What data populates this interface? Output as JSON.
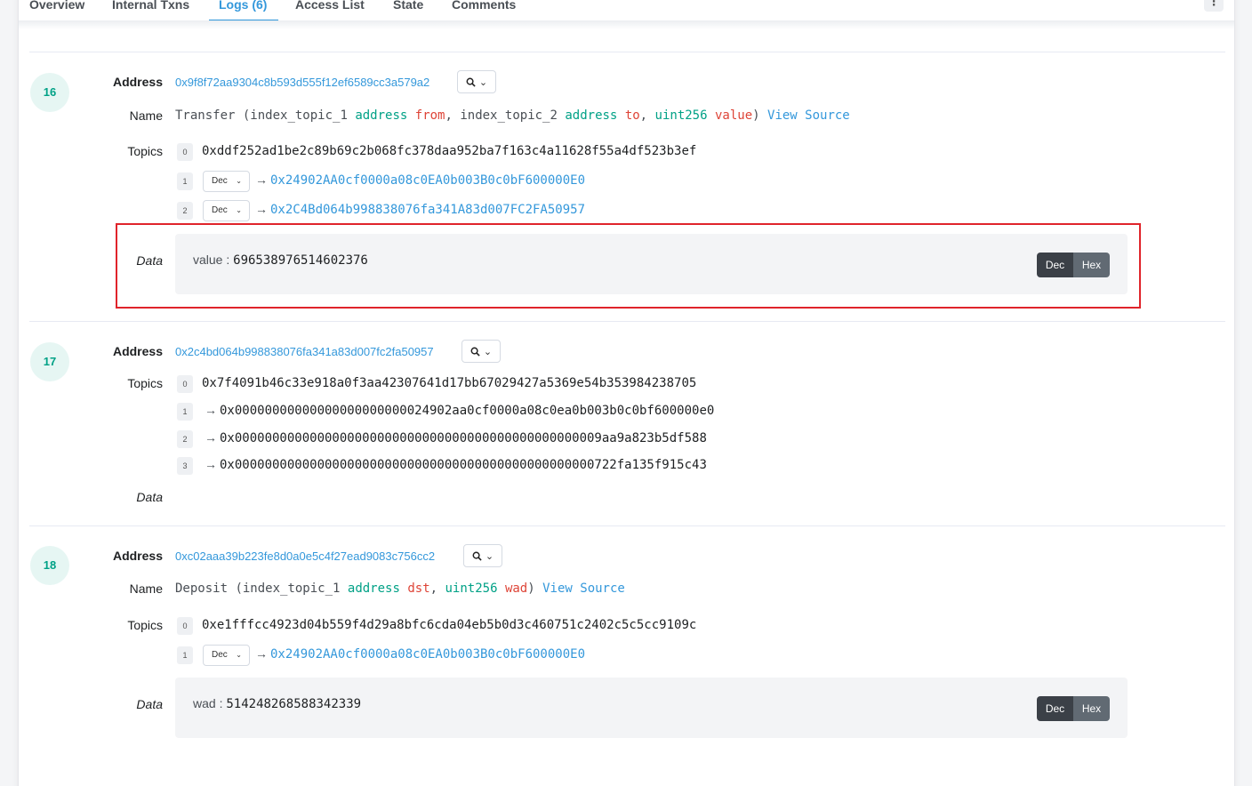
{
  "tabs": [
    "Overview",
    "Internal Txns",
    "Logs (6)",
    "Access List",
    "State",
    "Comments"
  ],
  "active_tab": "Logs (6)",
  "more_icon": "⋮",
  "labels": {
    "address": "Address",
    "name": "Name",
    "topics": "Topics",
    "data": "Data",
    "dec": "Dec",
    "hex": "Hex",
    "view_source": "View Source"
  },
  "logs": [
    {
      "index": "16",
      "address": "0x9f8f72aa9304c8b593d555f12ef6589cc3a579a2",
      "name": {
        "fn": "Transfer",
        "p1": "index_topic_1",
        "t1": "address",
        "n1": "from",
        "p2": "index_topic_2",
        "t2": "address",
        "n2": "to",
        "t3": "uint256",
        "n3": "value"
      },
      "topics": [
        "0xddf252ad1be2c89b69c2b068fc378daa952ba7f163c4a11628f55a4df523b3ef",
        "0x24902AA0cf0000a08c0EA0b003B0c0bF600000E0",
        "0x2C4Bd064b998838076fa341A83d007FC2FA50957"
      ],
      "data": {
        "key": "value",
        "val": "696538976514602376"
      }
    },
    {
      "index": "17",
      "address": "0x2c4bd064b998838076fa341a83d007fc2fa50957",
      "topics": [
        "0x7f4091b46c33e918a0f3aa42307641d17bb67029427a5369e54b353984238705",
        "0x00000000000000000000000024902aa0cf0000a08c0ea0b003b0c0bf600000e0",
        "0x0000000000000000000000000000000000000000000000009aa9a823b5df588",
        "0x000000000000000000000000000000000000000000000000722fa135f915c43"
      ]
    },
    {
      "index": "18",
      "address": "0xc02aaa39b223fe8d0a0e5c4f27ead9083c756cc2",
      "name": {
        "fn": "Deposit",
        "p1": "index_topic_1",
        "t1": "address",
        "n1": "dst",
        "t2": "uint256",
        "n2": "wad"
      },
      "topics": [
        "0xe1fffcc4923d04b559f4d29a8bfc6cda04eb5b0d3c460751c2402c5c5cc9109c",
        "0x24902AA0cf0000a08c0EA0b003B0c0bF600000E0"
      ],
      "data": {
        "key": "wad",
        "val": "514248268588342339"
      }
    }
  ]
}
